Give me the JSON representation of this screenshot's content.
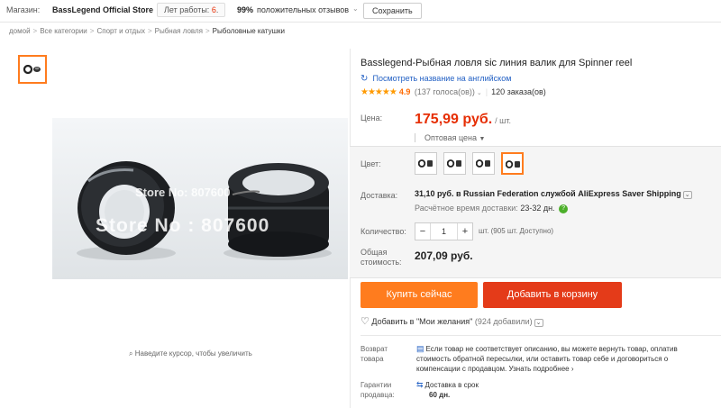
{
  "store_bar": {
    "label": "Магазин:",
    "name": "BassLegend Official Store",
    "years_label": "Лет работы:",
    "years_value": "6",
    "years_suffix": ".",
    "positive_pct": "99%",
    "positive_text": "положительных отзывов",
    "save_label": "Сохранить"
  },
  "breadcrumbs": [
    "домой",
    "Все категории",
    "Спорт и отдых",
    "Рыбная ловля",
    "Рыболовные катушки"
  ],
  "gallery": {
    "watermark_small": "Store No: 807600",
    "watermark_large": "Store No : 807600",
    "zoom_hint": "Наведите курсор, чтобы увеличить",
    "zoom_icon": "magnifier-icon"
  },
  "product": {
    "title": "Basslegend-Рыбная ловля sic линия валик для Spinner reel",
    "translate_link": "Посмотреть название на английском",
    "stars": "★★★★★",
    "rating": "4.9",
    "votes": "(137 голоса(ов))",
    "orders": "120 заказа(ов)"
  },
  "price": {
    "label": "Цена:",
    "amount": "175,99 руб.",
    "unit": "/ шт.",
    "wholesale": "Оптовая цена"
  },
  "color": {
    "label": "Цвет:",
    "selected_index": 3,
    "swatch_count": 4
  },
  "shipping": {
    "label": "Доставка:",
    "text": "31,10 руб. в Russian Federation службой AliExpress Saver Shipping",
    "time_label": "Расчётное время доставки:",
    "time_value": "23-32 дн."
  },
  "quantity": {
    "label": "Количество:",
    "value": "1",
    "note": "шт. (905 шт. Доступно)"
  },
  "total": {
    "label_line1": "Общая",
    "label_line2": "стоимость:",
    "value": "207,09 руб."
  },
  "actions": {
    "buy": "Купить сейчас",
    "cart": "Добавить в корзину",
    "wishlist": "Добавить в \"Мои желания\"",
    "wishlist_count": "(924 добавили)"
  },
  "returns": {
    "label_line1": "Возврат",
    "label_line2": "товара",
    "text": "Если товар не соответствует описанию, вы можете вернуть товар, оплатив стоимость обратной пересылки, или оставить товар себе и договориться о компенсации с продавцом.",
    "more": "Узнать подробнее"
  },
  "guarantee": {
    "label_line1": "Гарантии",
    "label_line2": "продавца:",
    "text": "Доставка в срок",
    "days": "60 дн."
  },
  "colors": {
    "accent": "#ff7c1e",
    "price": "#e62e04",
    "cart": "#e43b19",
    "link": "#2260c4"
  }
}
